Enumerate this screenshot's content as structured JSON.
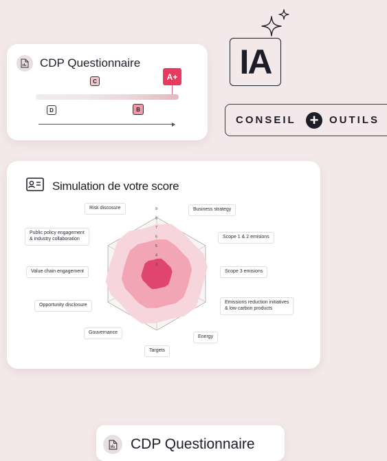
{
  "cdp_card": {
    "title": "CDP Questionnaire",
    "icon": "document-icon",
    "grades": {
      "c": "C",
      "d": "D",
      "b": "B",
      "a_plus": "A+"
    }
  },
  "logo": {
    "text": "IA",
    "icon": "sparkles-icon"
  },
  "conseil": {
    "left": "CONSEIL",
    "right": "OUTILS",
    "icon": "plus-circle-icon"
  },
  "simulation": {
    "title": "Simulation de votre score",
    "icon": "id-card-icon",
    "scale_ticks": [
      "3",
      "4",
      "5",
      "6",
      "7",
      "8",
      "9"
    ],
    "labels": {
      "risk": "Risk discosure",
      "business": "Business strategy",
      "public": "Public policy engagement\n& industry collaboration",
      "scope12": "Scope 1 & 2 emisions",
      "value_chain": "Value chain engagement",
      "scope3": "Scope 3 emisions",
      "opportunity": "Opportunity disclosure",
      "emissions": "Emissions reduction initiatives\n& low carbon products",
      "gouvernance": "Gouvernance",
      "energy": "Energy",
      "targets": "Targets"
    },
    "colors": {
      "inner": "#e0456f",
      "mid": "#f2a5b4",
      "outer": "#f7d5dc"
    }
  },
  "bottom_card": {
    "title": "CDP Questionnaire",
    "icon": "document-icon"
  }
}
